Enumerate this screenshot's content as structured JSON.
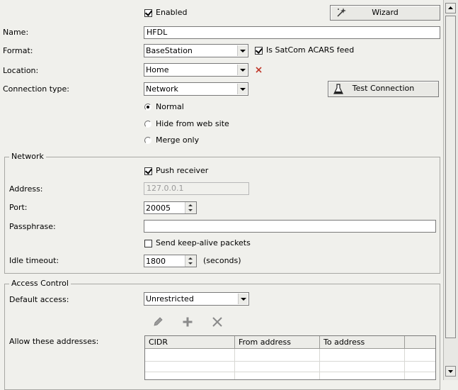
{
  "top": {
    "enabled_label": "Enabled",
    "enabled": true,
    "wizard_label": "Wizard"
  },
  "name": {
    "label": "Name:",
    "value": "HFDL"
  },
  "format": {
    "label": "Format:",
    "value": "BaseStation",
    "satcom_label": "Is SatCom ACARS feed",
    "satcom": true
  },
  "location": {
    "label": "Location:",
    "value": "Home"
  },
  "connection": {
    "label": "Connection type:",
    "value": "Network",
    "test_label": "Test Connection",
    "options": [
      {
        "label": "Normal",
        "selected": true
      },
      {
        "label": "Hide from web site",
        "selected": false
      },
      {
        "label": "Merge only",
        "selected": false
      }
    ]
  },
  "network": {
    "title": "Network",
    "push_label": "Push receiver",
    "push": true,
    "address_label": "Address:",
    "address_value": "127.0.0.1",
    "port_label": "Port:",
    "port_value": "20005",
    "passphrase_label": "Passphrase:",
    "passphrase_value": "",
    "keepalive_label": "Send keep-alive packets",
    "keepalive": false,
    "idle_label": "Idle timeout:",
    "idle_value": "1800",
    "idle_unit": "(seconds)"
  },
  "access": {
    "title": "Access Control",
    "default_label": "Default access:",
    "default_value": "Unrestricted",
    "allow_label": "Allow these addresses:",
    "columns": [
      "CIDR",
      "From address",
      "To address"
    ]
  },
  "icons": {
    "wizard": "wand-icon",
    "delete_location": "red-x-icon",
    "test": "flask-icon",
    "edit": "pencil-icon",
    "add": "plus-icon",
    "remove": "x-icon"
  },
  "colors": {
    "background": "#f0f0ec",
    "red_x": "#c0392b"
  }
}
